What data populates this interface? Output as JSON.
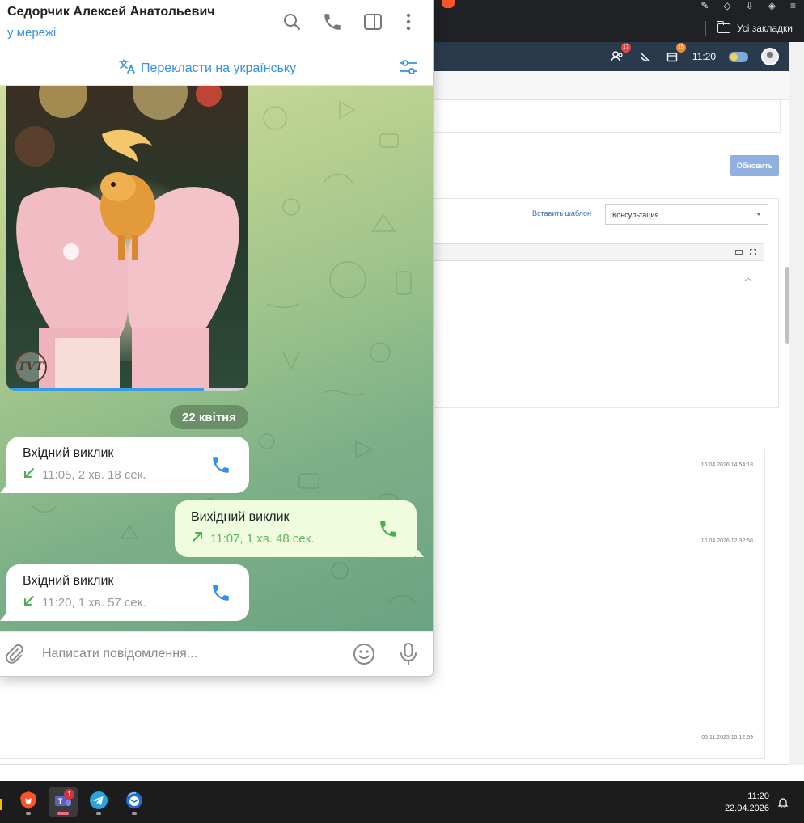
{
  "browser": {
    "bookmarks_label": "Усі закладки"
  },
  "crm": {
    "header": {
      "contacts_badge": "17",
      "calendar_badge": "15",
      "time": "11:20"
    },
    "update_button": "Обновить",
    "insert_template_link": "Вставить шаблон",
    "template_select": "Консультация",
    "history_timestamps": [
      "16.04.2026 14:54:13",
      "16.04.2026 12:32:58",
      "05.11.2025 15:12:59"
    ]
  },
  "telegram": {
    "contact_name": "Седорчик Алексей Анатольевич",
    "contact_status": "у мережі",
    "translate_label": "Перекласти на українську",
    "photo_caption_logo": "TVT",
    "photo_progress": 0.82,
    "date_separator": "22 квітня",
    "messages": [
      {
        "type": "incoming",
        "title": "Вхідний виклик",
        "meta": "11:05, 2 хв. 18 сек."
      },
      {
        "type": "outgoing",
        "title": "Вихідний виклик",
        "meta": "11:07, 1 хв. 48 сек."
      },
      {
        "type": "incoming",
        "title": "Вхідний виклик",
        "meta": "11:20, 1 хв. 57 сек."
      }
    ],
    "composer_placeholder": "Написати повідомлення..."
  },
  "taskbar": {
    "teams_badge": "1",
    "clock_time": "11:20",
    "clock_date": "22.04.2026"
  },
  "colors": {
    "accent": "#3390ec",
    "outgoing_bubble": "#effdde",
    "incoming_arrow": "#4caf50",
    "crm_header": "#2a3a4d"
  }
}
